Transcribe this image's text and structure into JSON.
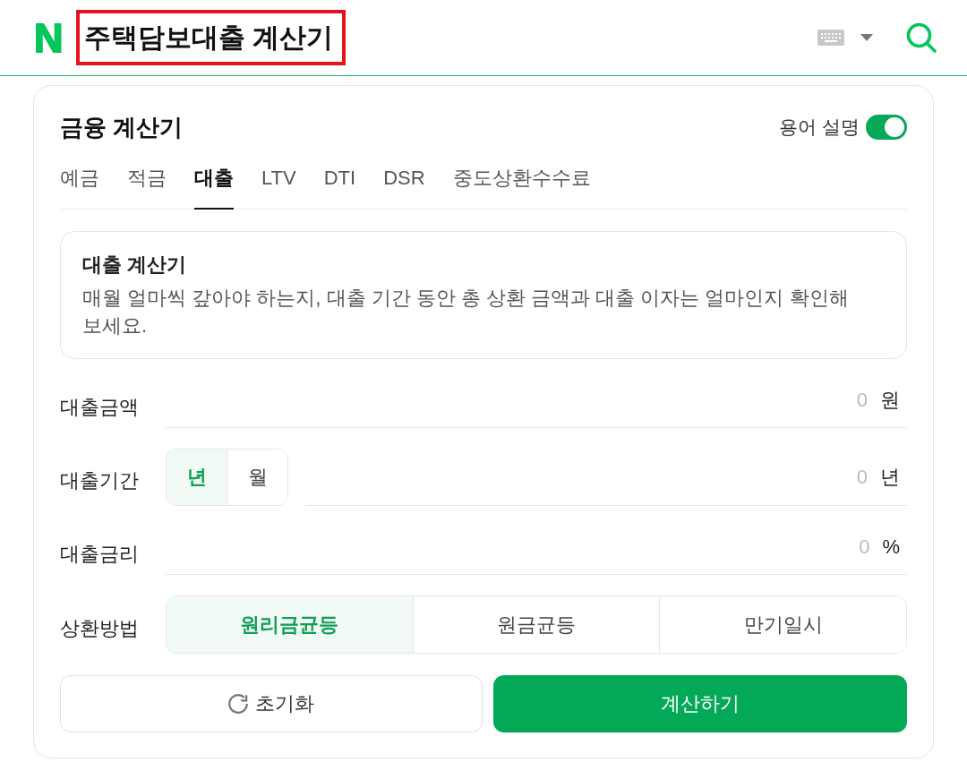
{
  "header": {
    "logo": "N",
    "query": "주택담보대출 계산기",
    "query_highlighted": true
  },
  "calculator": {
    "title": "금융 계산기",
    "glossary_toggle": {
      "label": "용어 설명",
      "on": true
    },
    "tabs": [
      {
        "label": "예금",
        "selected": false
      },
      {
        "label": "적금",
        "selected": false
      },
      {
        "label": "대출",
        "selected": true
      },
      {
        "label": "LTV",
        "selected": false
      },
      {
        "label": "DTI",
        "selected": false
      },
      {
        "label": "DSR",
        "selected": false
      },
      {
        "label": "중도상환수수료",
        "selected": false
      }
    ],
    "intro": {
      "title": "대출 계산기",
      "description": "매월 얼마씩 갚아야 하는지, 대출 기간 동안 총 상환 금액과 대출 이자는 얼마인지 확인해 보세요."
    },
    "fields": [
      {
        "kind": "number",
        "label": "대출금액",
        "placeholder": "0",
        "unit": "원"
      },
      {
        "kind": "number_with_options",
        "label": "대출기간",
        "options": [
          {
            "label": "년",
            "selected": true
          },
          {
            "label": "월",
            "selected": false
          }
        ],
        "placeholder": "0",
        "unit": "년"
      },
      {
        "kind": "number",
        "label": "대출금리",
        "placeholder": "0",
        "unit": "%"
      },
      {
        "kind": "options",
        "label": "상환방법",
        "options": [
          {
            "label": "원리금균등",
            "selected": true
          },
          {
            "label": "원금균등",
            "selected": false
          },
          {
            "label": "만기일시",
            "selected": false
          }
        ]
      }
    ],
    "buttons": [
      {
        "kind": "reset",
        "label": "초기화"
      },
      {
        "kind": "primary",
        "label": "계산하기"
      }
    ]
  }
}
